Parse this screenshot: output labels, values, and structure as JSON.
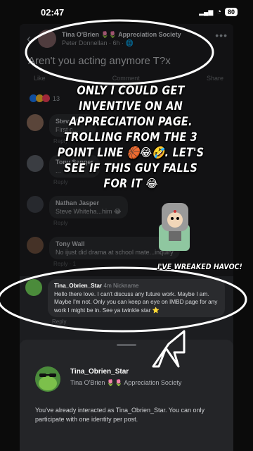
{
  "status": {
    "time": "02:47",
    "battery": "80",
    "signal": "▂▄▆",
    "wifi": "◔"
  },
  "post": {
    "back_glyph": "‹",
    "author": "Tina O'Brien 🌷🌷 Appreciation Society",
    "subline": "Peter Donnellan · 6h · 🌐",
    "more_glyph": "•••",
    "text": "Aren't you acting anymore T?x",
    "like": "Like",
    "comment": "Comment",
    "share": "Share",
    "reaction_count": "13"
  },
  "comments": [
    {
      "name": "Steve Wh...",
      "text": "First c...",
      "meta": "Reply"
    },
    {
      "name": "Tony Sanger",
      "text": "...",
      "meta": "Reply"
    },
    {
      "name": "Nathan Jasper",
      "text": "Steve Whiteha...him 😂",
      "meta": "Reply"
    },
    {
      "name": "Tony Wall",
      "text": "No ijust did drama at school mate...inquiry",
      "meta": "Reply · 1"
    }
  ],
  "highlight_comment": {
    "name": "Tina_Obrien_Star",
    "time": "4m",
    "nickname": "Nickname",
    "text": "Hello there love. I can't discuss any future work. Maybe I am. Maybe I'm not. Only you can keep an eye on IMBD page for any work I might be in. See ya twinkle star ⭐",
    "reply": "Reply"
  },
  "overlay": {
    "caption": "ONLY I COULD GET INVENTIVE ON AN APPRECIATION PAGE. TROLLING FROM THE 3 POINT LINE 🏀😂🤣. LET'S SEE IF THIS GUY FALLS FOR IT 😂",
    "havoc": "I'VE WREAKED HAVOC!"
  },
  "sheet": {
    "identity_name": "Tina_Obrien_Star",
    "identity_sub": "Tina O'Brien 🌷🌷 Appreciation Society",
    "note": "You've already interacted as Tina_Obrien_Star. You can only participate with one identity per post."
  },
  "colors": {
    "panel": "#1c1d20",
    "sheet": "#242528",
    "overlay_text": "#ffffff"
  }
}
